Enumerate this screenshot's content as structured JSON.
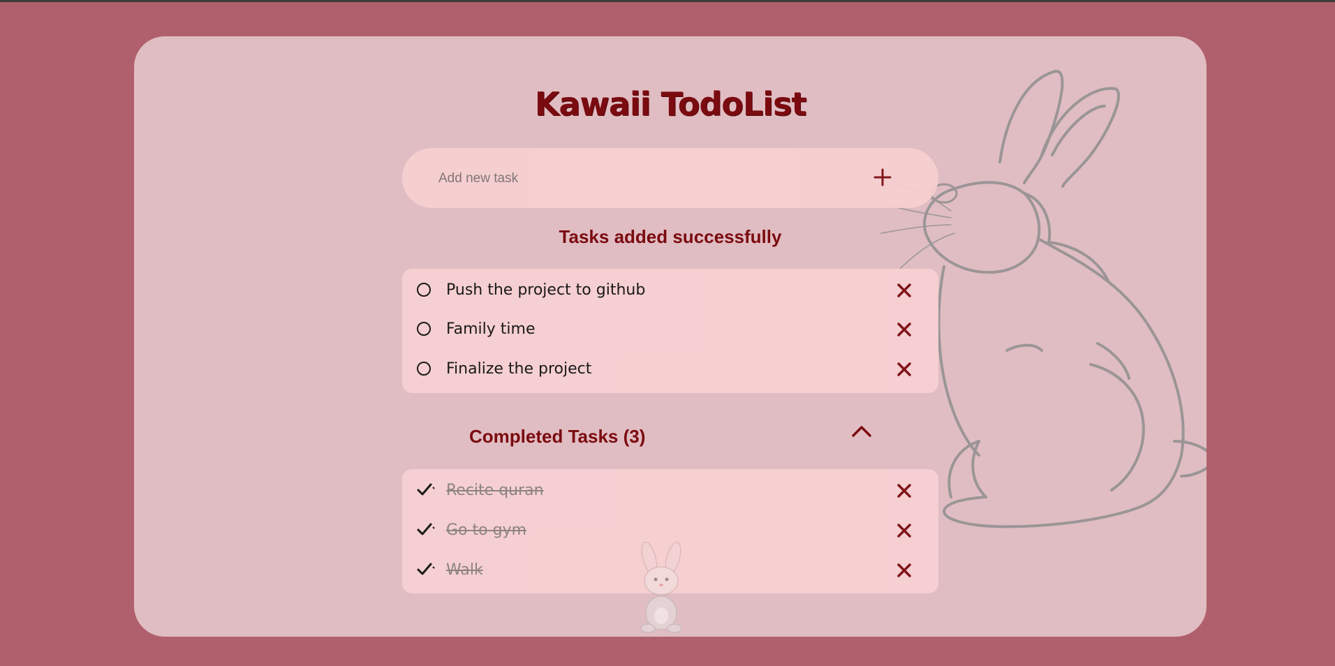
{
  "app": {
    "title": "Kawaii TodoList"
  },
  "input": {
    "placeholder": "Add new task",
    "value": "",
    "add_icon": "plus-icon"
  },
  "status_message": "Tasks added successfully",
  "pending_tasks": [
    {
      "text": "Push the project to github",
      "done": false
    },
    {
      "text": "Family time",
      "done": false
    },
    {
      "text": "Finalize the project",
      "done": false
    }
  ],
  "completed_section": {
    "label": "Completed Tasks (3)",
    "expanded": true,
    "toggle_icon": "chevron-up-icon"
  },
  "completed_tasks": [
    {
      "text": "Recite quran",
      "done": true
    },
    {
      "text": "Go to gym",
      "done": true
    },
    {
      "text": "Walk",
      "done": true
    }
  ],
  "colors": {
    "background": "#b0606c",
    "card": "#e0bdc2",
    "panel": "#f7d0d2",
    "accent": "#7a0b10",
    "completed_text": "#8a8080"
  }
}
